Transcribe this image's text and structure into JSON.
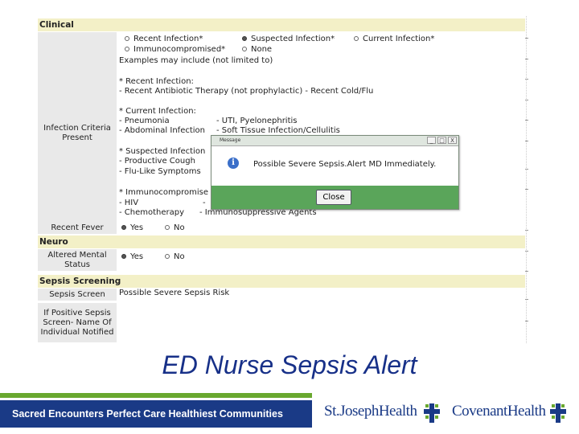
{
  "form": {
    "sections": {
      "clinical": "Clinical",
      "neuro": "Neuro",
      "sepsis": "Sepsis Screening"
    },
    "infection_criteria": {
      "label": "Infection Criteria Present",
      "options": [
        {
          "text": "Recent Infection*",
          "selected": false
        },
        {
          "text": "Suspected Infection*",
          "selected": true
        },
        {
          "text": "Current Infection*",
          "selected": false
        },
        {
          "text": "Immunocompromised*",
          "selected": false
        },
        {
          "text": "None",
          "selected": false
        }
      ],
      "lines": [
        "Examples may include (not limited to)",
        "* Recent Infection:",
        "- Recent Antibiotic Therapy (not prophylactic)   - Recent Cold/Flu",
        "* Current Infection:",
        "- Pneumonia",
        "- UTI, Pyelonephritis",
        "- Abdominal Infection",
        "- Soft Tissue Infection/Cellulitis",
        "* Suspected Infection",
        "- Productive Cough",
        "- Flu-Like Symptoms",
        "* Immunocompromise",
        "- HIV",
        "-",
        "- Chemotherapy",
        "- Immunosuppressive Agents"
      ]
    },
    "recent_fever": {
      "label": "Recent Fever",
      "yes": "Yes",
      "no": "No",
      "selected": "Yes"
    },
    "altered_mental": {
      "label": "Altered Mental Status",
      "yes": "Yes",
      "no": "No",
      "selected": "Yes"
    },
    "sepsis_screen": {
      "label": "Sepsis Screen",
      "value": "Possible Severe Sepsis Risk"
    },
    "notified": {
      "label": "If Positive Sepsis Screen- Name Of Individual Notified",
      "value": ""
    }
  },
  "dialog": {
    "title": "Message",
    "icon": "info-icon",
    "message": "Possible Severe Sepsis.Alert MD Immediately.",
    "close_label": "Close",
    "minimize_glyph": "_",
    "maximize_glyph": "□",
    "close_glyph": "X",
    "colors": {
      "footer": "#5aa55a",
      "icon": "#3b6fc9"
    }
  },
  "slide": {
    "caption": "ED Nurse Sepsis Alert",
    "tagline": "Sacred Encounters   Perfect Care   Healthiest Communities",
    "logos": [
      "St.JosephHealth",
      "CovenantHealth"
    ],
    "colors": {
      "blue": "#1a3a86",
      "green": "#69a82f",
      "section": "#f3f0c7",
      "label": "#e9e9e9"
    }
  }
}
